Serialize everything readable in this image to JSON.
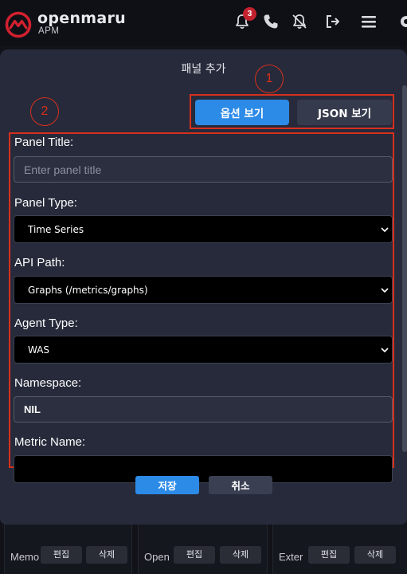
{
  "header": {
    "brand_name": "openmaru",
    "brand_sub": "APM",
    "notification_count": "3"
  },
  "modal": {
    "title": "패널 추가",
    "annotations": [
      "1",
      "2"
    ],
    "view_tabs": {
      "options": "옵션 보기",
      "json": "JSON 보기",
      "active": "options"
    },
    "fields": {
      "panel_title": {
        "label": "Panel Title:",
        "value": "",
        "placeholder": "Enter panel title"
      },
      "panel_type": {
        "label": "Panel Type:",
        "value": "Time Series"
      },
      "api_path": {
        "label": "API Path:",
        "value": "Graphs (/metrics/graphs)"
      },
      "agent_type": {
        "label": "Agent Type:",
        "value": "WAS"
      },
      "namespace": {
        "label": "Namespace:",
        "value": "NIL"
      },
      "metric_name": {
        "label": "Metric Name:",
        "value": ""
      }
    },
    "footer": {
      "save": "저장",
      "cancel": "취소"
    }
  },
  "background_cards": [
    {
      "label": "Memo",
      "edit": "편집",
      "delete": "삭제"
    },
    {
      "label": "Open",
      "edit": "편집",
      "delete": "삭제"
    },
    {
      "label": "Exter",
      "edit": "편집",
      "delete": "삭제"
    }
  ],
  "colors": {
    "accent": "#2d8be8",
    "modal_bg": "#262a3a",
    "annotation": "#d8301e",
    "badge": "#c2222e"
  }
}
